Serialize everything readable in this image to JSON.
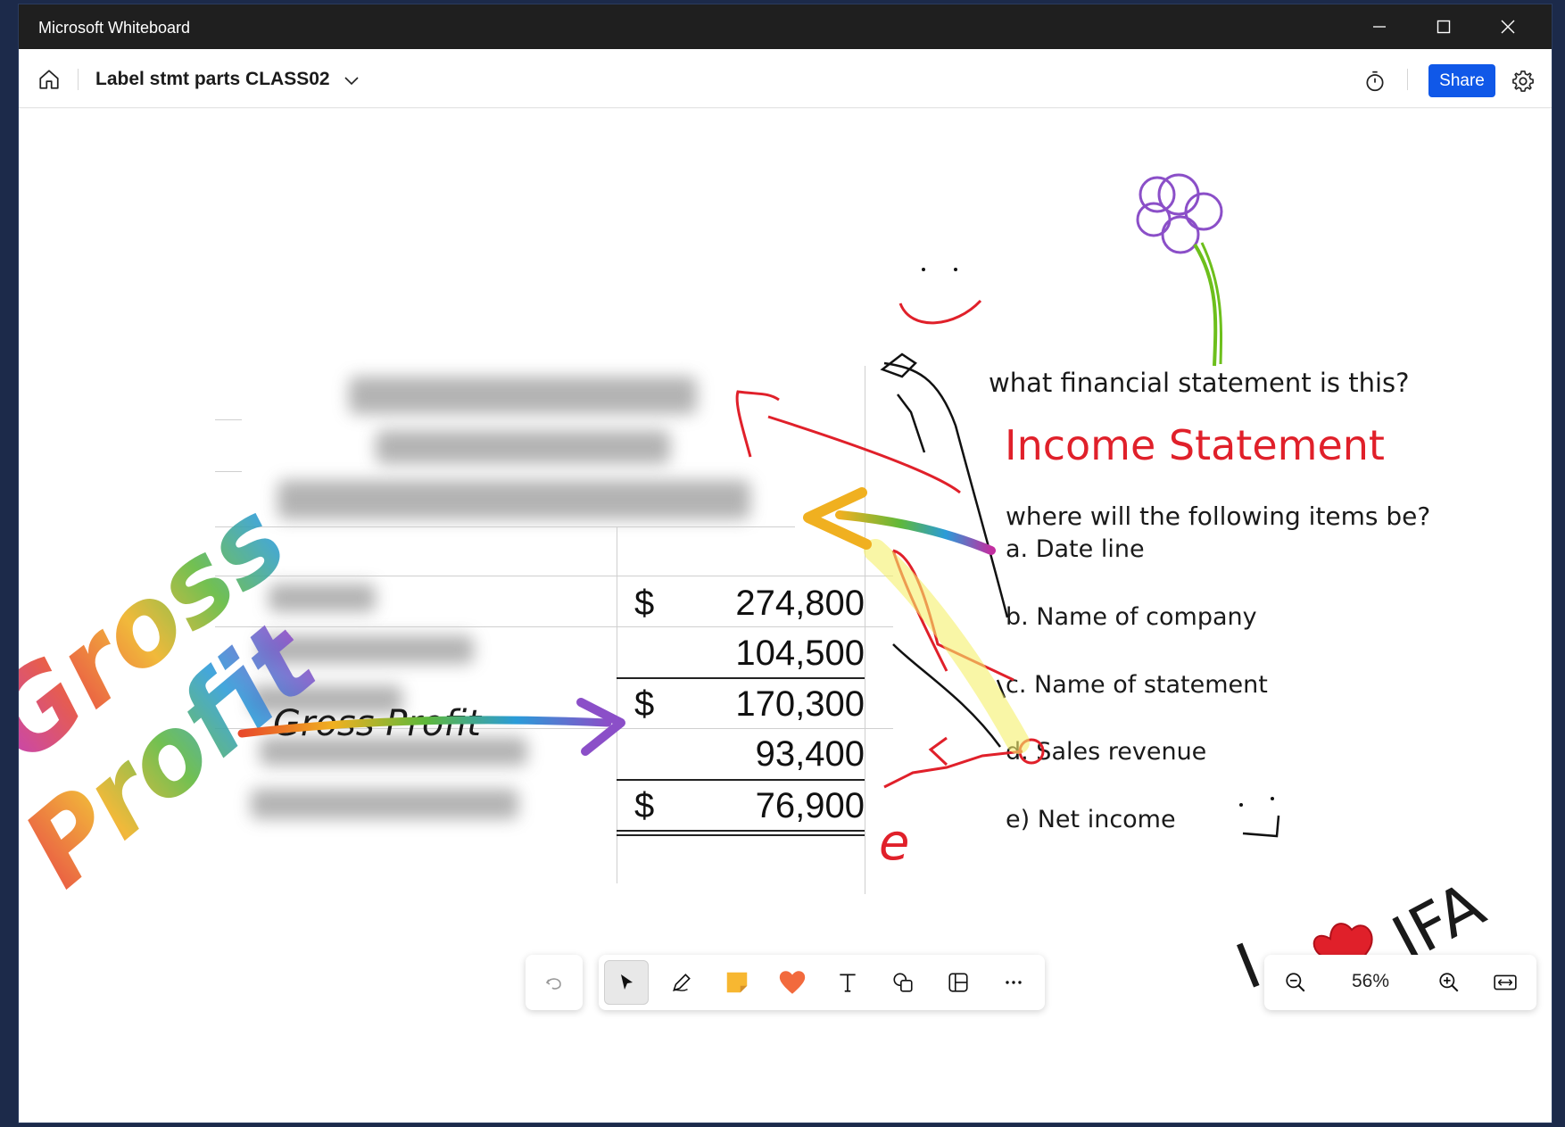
{
  "window": {
    "app_title": "Microsoft Whiteboard",
    "controls": [
      "minimize",
      "maximize",
      "close"
    ]
  },
  "header": {
    "board_title": "Label stmt parts CLASS02",
    "share_label": "Share"
  },
  "financial_table": {
    "rows": [
      {
        "dollar": "$",
        "amount": "274,800"
      },
      {
        "dollar": "",
        "amount": "104,500"
      },
      {
        "dollar": "$",
        "amount": "170,300"
      },
      {
        "dollar": "",
        "amount": "93,400"
      },
      {
        "dollar": "$",
        "amount": "76,900"
      }
    ]
  },
  "annotations": {
    "question": "what financial statement is this?",
    "answer": "Income Statement",
    "prompt": "where will the following items be?",
    "items": [
      "a. Date line",
      "b. Name of company",
      "c. Name of statement",
      "d. Sales revenue",
      "e) Net income"
    ],
    "gross_profit_label": "Gross Profit",
    "big_gross": "Gross",
    "big_profit": "Profit",
    "letter_e": "e",
    "love_i": "I",
    "love_ifa": "IFA"
  },
  "colors": {
    "share_blue": "#1058e8",
    "ink_red": "#e0202a",
    "ink_black": "#111111",
    "flower_purple": "#8b4fc8",
    "stem_green": "#6dbf1c",
    "highlight_yellow": "#f5f06a"
  },
  "toolbar": {
    "tools": [
      "undo-icon",
      "select-icon",
      "pen-icon",
      "sticky-note-icon",
      "reaction-heart-icon",
      "text-icon",
      "shapes-icon",
      "templates-icon",
      "more-icon"
    ],
    "zoom_label": "56%"
  }
}
